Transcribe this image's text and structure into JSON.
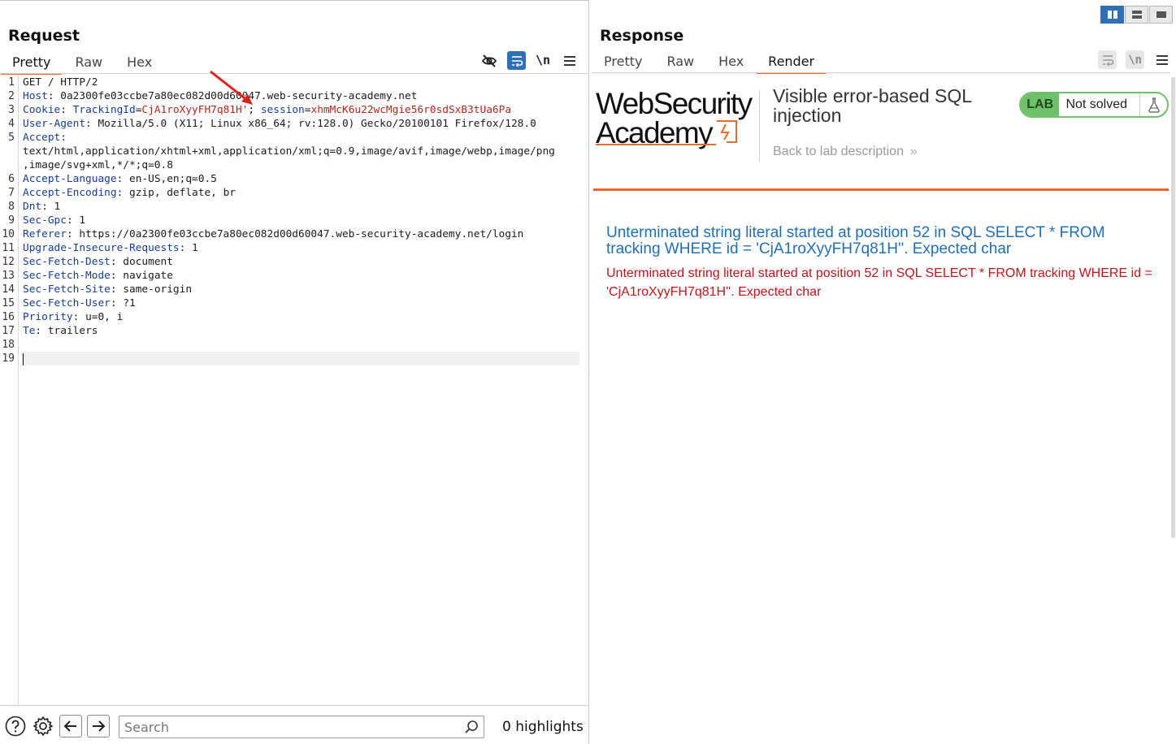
{
  "request": {
    "title": "Request",
    "tabs": [
      "Pretty",
      "Raw",
      "Hex"
    ],
    "active_tab": "Pretty",
    "toolbar": {
      "newline_label": "\\n"
    },
    "line_numbers": [
      "1",
      "2",
      "3",
      "4",
      "5",
      "",
      "",
      "6",
      "7",
      "8",
      "9",
      "10",
      "11",
      "12",
      "13",
      "14",
      "15",
      "16",
      "17",
      "18",
      "19"
    ],
    "lines": [
      {
        "key": "",
        "sep": "",
        "value": "GET / HTTP/2"
      },
      {
        "key": "Host",
        "sep": ": ",
        "value": "0a2300fe03ccbe7a80ec082d00d60047.web-security-academy.net"
      },
      {
        "key": "Cookie",
        "sep": ": ",
        "value": ""
      },
      {
        "key": "User-Agent",
        "sep": ": ",
        "value": "Mozilla/5.0 (X11; Linux x86_64; rv:128.0) Gecko/20100101 Firefox/128.0"
      },
      {
        "key": "Accept",
        "sep": ":",
        "value": ""
      },
      {
        "key": "",
        "sep": "",
        "value": "text/html,application/xhtml+xml,application/xml;q=0.9,image/avif,image/webp,image/png"
      },
      {
        "key": "",
        "sep": "",
        "value": ",image/svg+xml,*/*;q=0.8"
      },
      {
        "key": "Accept-Language",
        "sep": ": ",
        "value": "en-US,en;q=0.5"
      },
      {
        "key": "Accept-Encoding",
        "sep": ": ",
        "value": "gzip, deflate, br"
      },
      {
        "key": "Dnt",
        "sep": ": ",
        "value": "1"
      },
      {
        "key": "Sec-Gpc",
        "sep": ": ",
        "value": "1"
      },
      {
        "key": "Referer",
        "sep": ": ",
        "value": "https://0a2300fe03ccbe7a80ec082d00d60047.web-security-academy.net/login"
      },
      {
        "key": "Upgrade-Insecure-Requests",
        "sep": ": ",
        "value": "1"
      },
      {
        "key": "Sec-Fetch-Dest",
        "sep": ": ",
        "value": "document"
      },
      {
        "key": "Sec-Fetch-Mode",
        "sep": ": ",
        "value": "navigate"
      },
      {
        "key": "Sec-Fetch-Site",
        "sep": ": ",
        "value": "same-origin"
      },
      {
        "key": "Sec-Fetch-User",
        "sep": ": ",
        "value": "?1"
      },
      {
        "key": "Priority",
        "sep": ": ",
        "value": "u=0, i"
      },
      {
        "key": "Te",
        "sep": ": ",
        "value": "trailers"
      },
      {
        "key": "",
        "sep": "",
        "value": ""
      },
      {
        "key": "",
        "sep": "",
        "value": ""
      }
    ],
    "cookie": {
      "tracking_key": "TrackingId",
      "tracking_value": "CjA1roXyyFH7q81H'",
      "separator": "; ",
      "session_key": "session",
      "session_value": "xhmMcK6u22wcMgie56r0sdSxB3tUa6Pa"
    },
    "search": {
      "placeholder": "Search",
      "value": ""
    },
    "highlights": "0 highlights"
  },
  "response": {
    "title": "Response",
    "tabs": [
      "Pretty",
      "Raw",
      "Hex",
      "Render"
    ],
    "active_tab": "Render",
    "toolbar": {
      "newline_label": "\\n"
    },
    "rendered": {
      "logo_line1": "WebSecurity",
      "logo_line2": "Academy",
      "lab_title": "Visible error-based SQL injection",
      "back_link": "Back to lab description",
      "back_chevron": "»",
      "lab_badge": "LAB",
      "lab_status": "Not solved",
      "error_heading": "Unterminated string literal started at position 52 in SQL SELECT * FROM tracking WHERE id = 'CjA1roXyyFH7q81H''. Expected char",
      "error_body": "Unterminated string literal started at position 52 in SQL SELECT * FROM tracking WHERE id = 'CjA1roXyyFH7q81H''. Expected char"
    }
  },
  "colors": {
    "accent": "#e8692e",
    "selected_tool": "#2f6fb5",
    "header_key": "#163d96",
    "cookie_value": "#b3261e",
    "lab_green": "#6fc06b",
    "error_blue": "#1f6fb5",
    "error_red": "#c0141a"
  },
  "icons": [
    "hide-eye-icon",
    "wrap-lines-icon",
    "newline-icon",
    "menu-icon",
    "help-icon",
    "gear-icon",
    "back-arrow-icon",
    "forward-arrow-icon",
    "search-icon",
    "layout-split-icon",
    "layout-stack-icon",
    "layout-single-icon",
    "flask-icon",
    "annotation-arrow-icon"
  ]
}
